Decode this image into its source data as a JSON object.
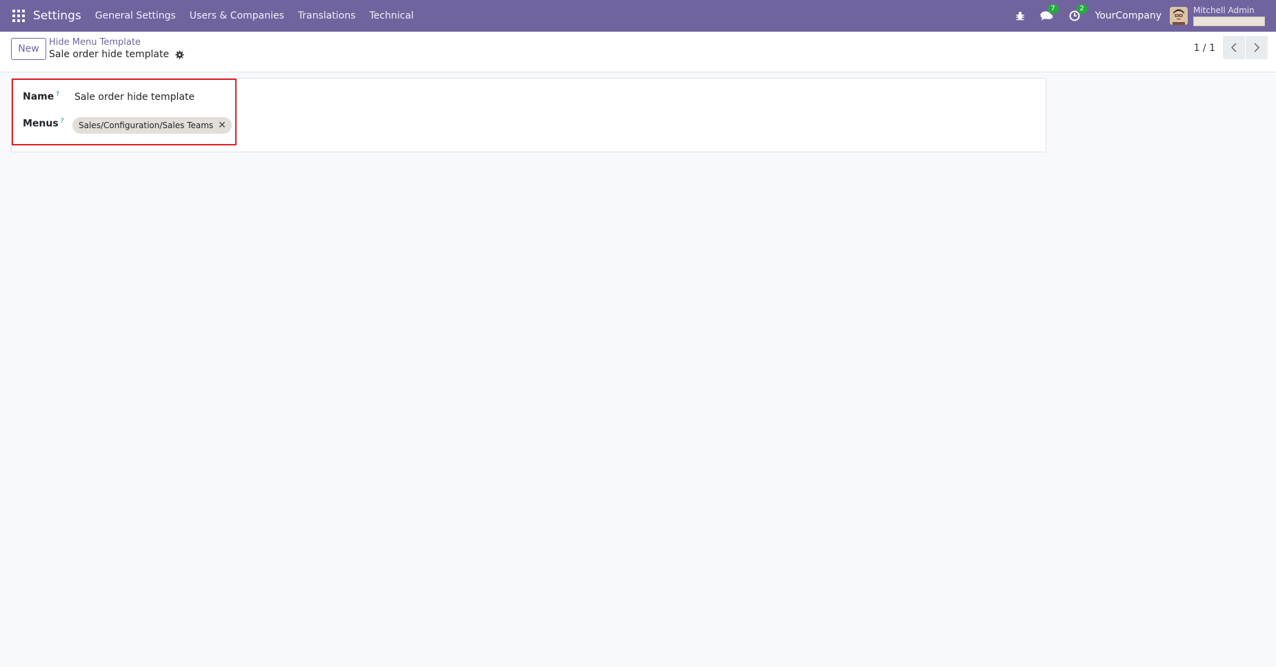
{
  "navbar": {
    "app_name": "Settings",
    "menus": [
      "General Settings",
      "Users & Companies",
      "Translations",
      "Technical"
    ],
    "messages_count": "7",
    "activities_count": "2",
    "company": "YourCompany",
    "user_name": "Mitchell Admin"
  },
  "control_panel": {
    "new_label": "New",
    "breadcrumb": "Hide Menu Template",
    "record_title": "Sale order hide template",
    "pager": "1 / 1"
  },
  "form": {
    "name_label": "Name",
    "name_value": "Sale order hide template",
    "menus_label": "Menus",
    "help_mark": "?",
    "menu_tags": [
      "Sales/Configuration/Sales Teams"
    ]
  },
  "colors": {
    "navbar": "#71639e",
    "accent": "#71639e",
    "highlight": "#e31b23",
    "badge": "#28a745"
  }
}
